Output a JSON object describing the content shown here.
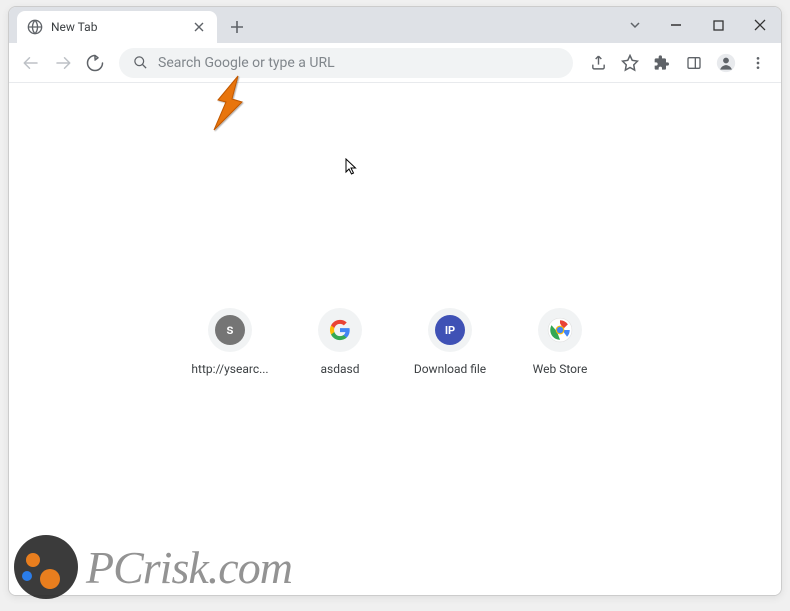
{
  "window": {
    "tab_title": "New Tab"
  },
  "toolbar": {
    "omnibox_placeholder": "Search Google or type a URL"
  },
  "shortcuts": [
    {
      "label": "http://ysearc...",
      "icon_type": "s"
    },
    {
      "label": "asdasd",
      "icon_type": "google"
    },
    {
      "label": "Download file",
      "icon_type": "ip"
    },
    {
      "label": "Web Store",
      "icon_type": "webstore"
    }
  ],
  "watermark": {
    "text": "PCrisk.com"
  }
}
